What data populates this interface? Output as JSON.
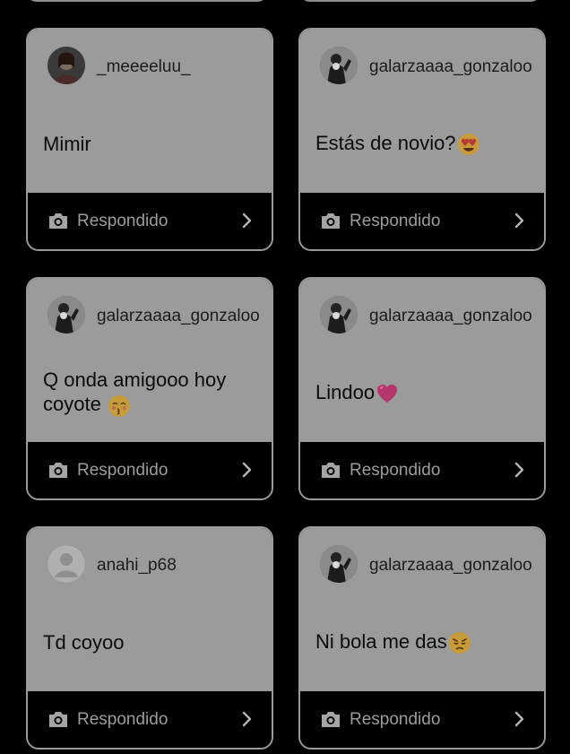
{
  "cards": [
    {
      "username": "_meeeeluu_",
      "message": "Mimir",
      "emoji": "",
      "avatar": "photo-woman-avatar",
      "status": "Respondido"
    },
    {
      "username": "galarzaaaa_gonzaloo",
      "message": "Estás de novio?",
      "emoji": "heart-eyes-emoji",
      "avatar": "photo-man-avatar",
      "status": "Respondido"
    },
    {
      "username": "galarzaaaa_gonzaloo",
      "message": "Q onda amigooo hoy coyote",
      "emoji": "kissing-closed-eyes-emoji",
      "avatar": "photo-man-avatar",
      "status": "Respondido"
    },
    {
      "username": "galarzaaaa_gonzaloo",
      "message": "Lindoo",
      "emoji": "pink-heart-emoji",
      "avatar": "photo-man-avatar",
      "status": "Respondido"
    },
    {
      "username": "anahi_p68",
      "message": "Td coyoo",
      "emoji": "",
      "avatar": "default-avatar",
      "status": "Respondido"
    },
    {
      "username": "galarzaaaa_gonzaloo",
      "message": "Ni bola me das",
      "emoji": "disappointed-emoji",
      "avatar": "photo-man-avatar",
      "status": "Respondido"
    }
  ],
  "colors": {
    "background": "#000000",
    "card_upper": "#9b9b9b",
    "card_border": "#9a9a9a",
    "status_text": "#9c9c9c"
  }
}
